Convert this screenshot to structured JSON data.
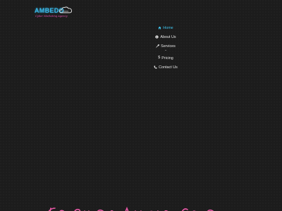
{
  "brand": {
    "name": "AMBEDO",
    "tagline": "Cyber Marketing Agency",
    "accent_color": "#39b8e8",
    "tagline_color": "#e64fb0"
  },
  "nav": {
    "items": [
      {
        "label": "Home",
        "icon": "home-icon",
        "active": true
      },
      {
        "label": "About Us",
        "icon": "info-icon",
        "active": false
      },
      {
        "label": "Services",
        "icon": "wrench-icon",
        "active": false,
        "has_dropdown": true
      },
      {
        "label": "Pricing",
        "icon": "dollar-icon",
        "active": false
      },
      {
        "label": "Contact Us",
        "icon": "phone-icon",
        "active": false
      }
    ],
    "active_color": "#3fc4ee",
    "text_color": "#e6e6e6"
  },
  "hero": {
    "neon_color": "#ff5fb6"
  }
}
